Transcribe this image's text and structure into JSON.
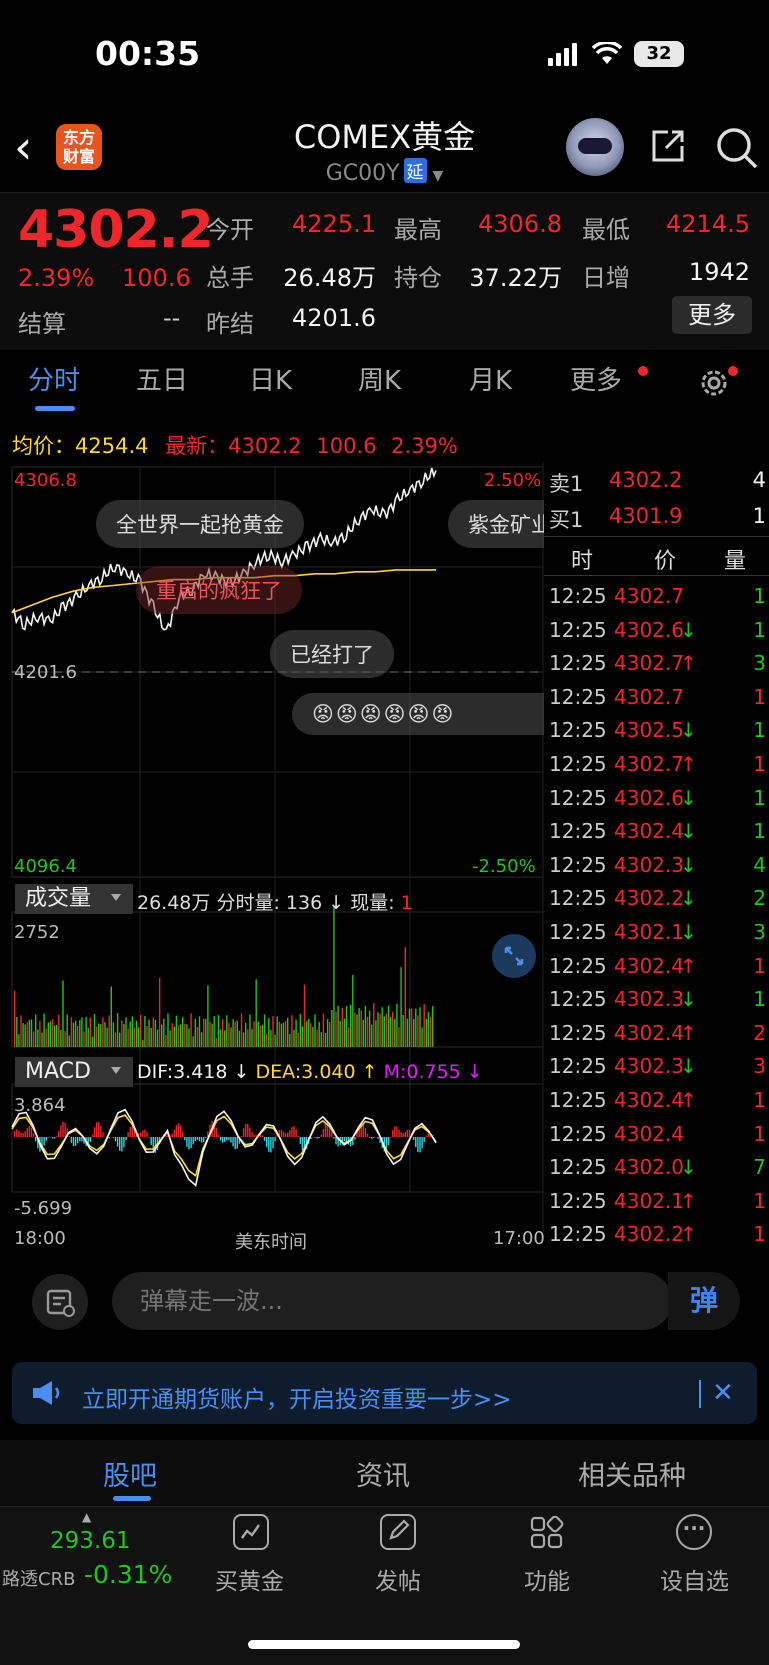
{
  "status_bar": {
    "time": "00:35",
    "battery": "32"
  },
  "header": {
    "logo": "东方财富",
    "title": "COMEX黄金",
    "code": "GC00Y",
    "delay_badge": "延"
  },
  "quote": {
    "last": "4302.2",
    "pct": "2.39%",
    "chg": "100.6",
    "settle_label": "结算",
    "settle_value": "--",
    "open_label": "今开",
    "open": "4225.1",
    "high_label": "最高",
    "high": "4306.8",
    "low_label": "最低",
    "low": "4214.5",
    "vol_label": "总手",
    "vol": "26.48万",
    "oi_label": "持仓",
    "oi": "37.22万",
    "oi_chg_label": "日增",
    "oi_chg": "1942",
    "prev_settle_label": "昨结",
    "prev_settle": "4201.6",
    "more_btn": "更多"
  },
  "tabs": [
    "分时",
    "五日",
    "日K",
    "周K",
    "月K",
    "更多"
  ],
  "avg_row": {
    "avg_label": "均价：",
    "avg": "4254.4",
    "latest_label": "最新：",
    "latest": "4302.2",
    "chg": "100.6",
    "pct": "2.39%"
  },
  "chart_labels": {
    "top_price": "4306.8",
    "top_pct": "2.50%",
    "mid_price": "4201.6",
    "bottom_price": "4096.4",
    "bottom_pct": "-2.50%",
    "vol_max": "2752",
    "macd_max": "3.864",
    "macd_min": "-5.699",
    "time_start": "18:00",
    "time_mid": "美东时间",
    "time_end": "17:00"
  },
  "danmu": [
    "全世界一起抢黄金",
    "紫金矿业",
    "重启的疯狂了",
    "已经打了",
    "😡😡😡😡😡😡"
  ],
  "volume": {
    "selector": "成交量",
    "total": "26.48万",
    "slice_label": "分时量:",
    "slice": "136",
    "now_label": "现量:",
    "now": "1"
  },
  "macd": {
    "selector": "MACD",
    "dif": "DIF:3.418",
    "dea": "DEA:3.040",
    "m": "M:0.755"
  },
  "order_book": {
    "ask_label": "卖1",
    "ask_price": "4302.2",
    "ask_qty": "4",
    "bid_label": "买1",
    "bid_price": "4301.9",
    "bid_qty": "1",
    "head_time": "时",
    "head_price": "价",
    "head_qty": "量"
  },
  "trades": [
    {
      "time": "12:25",
      "price": "4302.7",
      "dir": "",
      "qty": "1",
      "qcolor": "green"
    },
    {
      "time": "12:25",
      "price": "4302.6",
      "dir": "↓",
      "qty": "1",
      "qcolor": "green"
    },
    {
      "time": "12:25",
      "price": "4302.7",
      "dir": "↑",
      "qty": "3",
      "qcolor": "green"
    },
    {
      "time": "12:25",
      "price": "4302.7",
      "dir": "",
      "qty": "1",
      "qcolor": "red"
    },
    {
      "time": "12:25",
      "price": "4302.5",
      "dir": "↓",
      "qty": "1",
      "qcolor": "green"
    },
    {
      "time": "12:25",
      "price": "4302.7",
      "dir": "↑",
      "qty": "1",
      "qcolor": "red"
    },
    {
      "time": "12:25",
      "price": "4302.6",
      "dir": "↓",
      "qty": "1",
      "qcolor": "green"
    },
    {
      "time": "12:25",
      "price": "4302.4",
      "dir": "↓",
      "qty": "1",
      "qcolor": "green"
    },
    {
      "time": "12:25",
      "price": "4302.3",
      "dir": "↓",
      "qty": "4",
      "qcolor": "green"
    },
    {
      "time": "12:25",
      "price": "4302.2",
      "dir": "↓",
      "qty": "2",
      "qcolor": "green"
    },
    {
      "time": "12:25",
      "price": "4302.1",
      "dir": "↓",
      "qty": "3",
      "qcolor": "green"
    },
    {
      "time": "12:25",
      "price": "4302.4",
      "dir": "↑",
      "qty": "1",
      "qcolor": "red"
    },
    {
      "time": "12:25",
      "price": "4302.3",
      "dir": "↓",
      "qty": "1",
      "qcolor": "green"
    },
    {
      "time": "12:25",
      "price": "4302.4",
      "dir": "↑",
      "qty": "2",
      "qcolor": "red"
    },
    {
      "time": "12:25",
      "price": "4302.3",
      "dir": "↓",
      "qty": "3",
      "qcolor": "red"
    },
    {
      "time": "12:25",
      "price": "4302.4",
      "dir": "↑",
      "qty": "1",
      "qcolor": "red"
    },
    {
      "time": "12:25",
      "price": "4302.4",
      "dir": "",
      "qty": "1",
      "qcolor": "red"
    },
    {
      "time": "12:25",
      "price": "4302.0",
      "dir": "↓",
      "qty": "7",
      "qcolor": "green"
    },
    {
      "time": "12:25",
      "price": "4302.1",
      "dir": "↑",
      "qty": "1",
      "qcolor": "red"
    },
    {
      "time": "12:25",
      "price": "4302.2",
      "dir": "↑",
      "qty": "1",
      "qcolor": "red"
    }
  ],
  "comment": {
    "placeholder": "弹幕走一波...",
    "danmu_btn": "弹"
  },
  "promo": {
    "text": "立即开通期货账户，开启投资重要一步>>"
  },
  "bottom_tabs": [
    "股吧",
    "资讯",
    "相关品种"
  ],
  "bottom_nav": {
    "ticker_value": "293.61",
    "ticker_name": "路透CRB",
    "ticker_pct": "-0.31%",
    "items": [
      "买黄金",
      "发帖",
      "功能",
      "设自选"
    ]
  },
  "colors": {
    "up": "#f0262d",
    "down": "#22c41e",
    "accent": "#4a8ff0",
    "avg_line": "#ffd633"
  },
  "chart_data": {
    "type": "line",
    "title": "",
    "y_range": [
      4096.4,
      4306.8
    ],
    "prev_settle": 4201.6,
    "x_range_label": [
      "18:00",
      "17:00"
    ],
    "series": [
      {
        "name": "",
        "values": [
          4232,
          4226,
          4230,
          4228,
          4235,
          4240,
          4246,
          4250,
          4256,
          4252,
          4248,
          4235,
          4222,
          4240,
          4244,
          4252,
          4250,
          4247,
          4252,
          4258,
          4262,
          4258,
          4262,
          4266,
          4270,
          4268,
          4272,
          4280,
          4285,
          4282,
          4290,
          4295,
          4300,
          4305
        ]
      },
      {
        "name": "",
        "values": [
          4232,
          4236,
          4240,
          4243,
          4245,
          4246,
          4247,
          4248,
          4249,
          4249,
          4250,
          4250,
          4250,
          4251,
          4251,
          4252,
          4252,
          4253,
          4253,
          4254,
          4254,
          4254
        ]
      }
    ]
  }
}
